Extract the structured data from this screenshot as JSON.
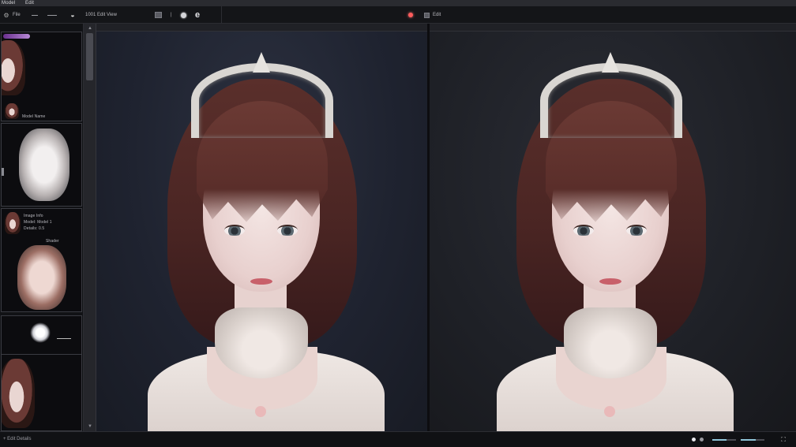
{
  "titlebar": {
    "left_text": "Model",
    "menu_text": "Edit"
  },
  "toolbar": {
    "item_file": "File",
    "item_title": "1001 Edit View",
    "item_sep": "|",
    "item_right": "Edit"
  },
  "left_panel": {
    "thumb1_caption": "Model Name",
    "thumb3_caption_lines": [
      "Image Info",
      "Model: Model 1",
      "Details: 0.5"
    ],
    "thumb3_label": "Shader"
  },
  "status_bar": {
    "left_text": "+ Edit Details",
    "zoom_level": 0.62
  },
  "colors": {
    "accent": "#8fc5d8",
    "panel_bg": "#111215",
    "record": "#ff5c5c"
  }
}
